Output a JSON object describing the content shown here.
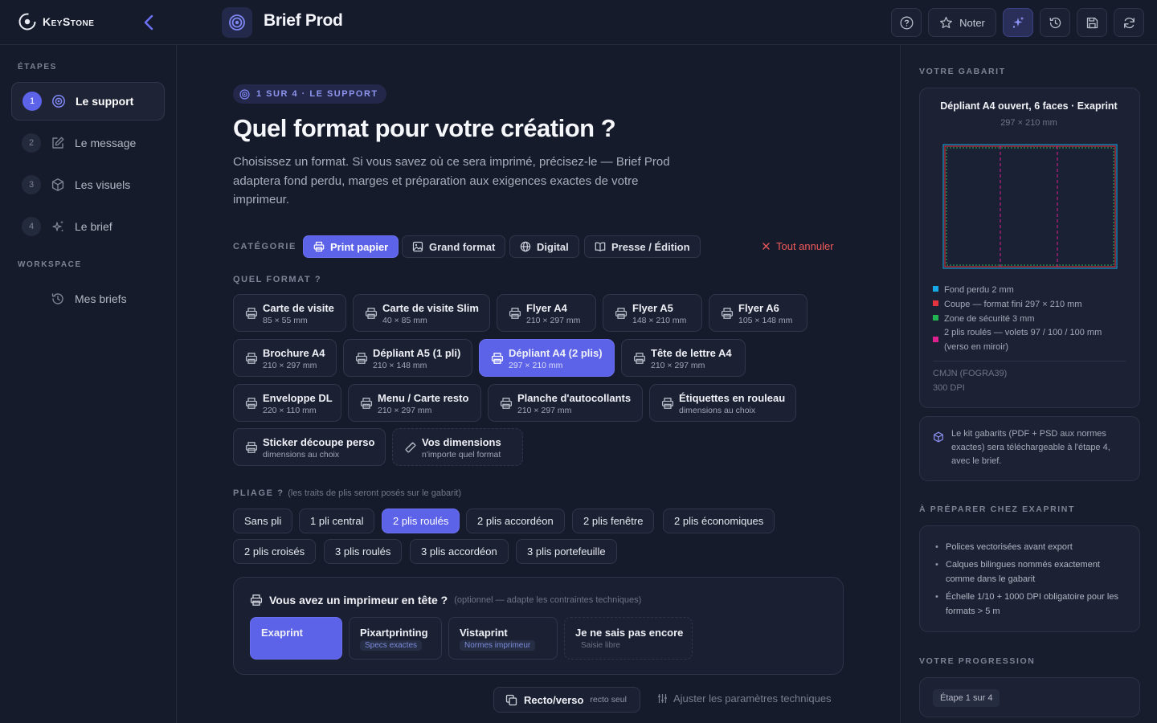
{
  "app": {
    "logo_text": "KeyStone",
    "project_title": "Brief Prod"
  },
  "toolbar": {
    "rate_label": "Noter"
  },
  "sidebar": {
    "steps_heading": "ÉTAPES",
    "steps": [
      {
        "num": "1",
        "label": "Le support",
        "icon": "target-icon",
        "active": true
      },
      {
        "num": "2",
        "label": "Le message",
        "icon": "edit-icon"
      },
      {
        "num": "3",
        "label": "Les visuels",
        "icon": "cube-icon"
      },
      {
        "num": "4",
        "label": "Le brief",
        "icon": "sparkles-icon"
      }
    ],
    "workspace_heading": "WORKSPACE",
    "workspace_items": [
      {
        "label": "Mes briefs",
        "icon": "history-icon"
      }
    ]
  },
  "main": {
    "crumb": "1 SUR 4 · LE SUPPORT",
    "title": "Quel format pour votre création ?",
    "lede": "Choisissez un format. Si vous savez où ce sera imprimé, précisez-le — Brief Prod adaptera fond perdu, marges et préparation aux exigences exactes de votre imprimeur.",
    "category_label": "CATÉGORIE",
    "categories": [
      {
        "label": "Print papier",
        "active": true
      },
      {
        "label": "Grand format"
      },
      {
        "label": "Digital"
      },
      {
        "label": "Presse / Édition"
      }
    ],
    "cancel_label": "Tout annuler",
    "format_label": "QUEL FORMAT ?",
    "formats": [
      {
        "name": "Carte de visite",
        "dim": "85 × 55 mm"
      },
      {
        "name": "Carte de visite Slim",
        "dim": "40 × 85 mm"
      },
      {
        "name": "Flyer A4",
        "dim": "210 × 297 mm"
      },
      {
        "name": "Flyer A5",
        "dim": "148 × 210 mm"
      },
      {
        "name": "Flyer A6",
        "dim": "105 × 148 mm"
      },
      {
        "name": "Brochure A4",
        "dim": "210 × 297 mm"
      },
      {
        "name": "Dépliant A5 (1 pli)",
        "dim": "210 × 148 mm"
      },
      {
        "name": "Dépliant A4 (2 plis)",
        "dim": "297 × 210 mm",
        "active": true
      },
      {
        "name": "Tête de lettre A4",
        "dim": "210 × 297 mm"
      },
      {
        "name": "Enveloppe DL",
        "dim": "220 × 110 mm"
      },
      {
        "name": "Menu / Carte resto",
        "dim": "210 × 297 mm"
      },
      {
        "name": "Planche d'autocollants",
        "dim": "210 × 297 mm"
      },
      {
        "name": "Étiquettes en rouleau",
        "dim": "dimensions au choix"
      },
      {
        "name": "Sticker découpe perso",
        "dim": "dimensions au choix"
      },
      {
        "name": "Vos dimensions",
        "dim": "n'importe quel format"
      }
    ],
    "fold_label": "PLIAGE ?",
    "fold_sub": "(les traits de plis seront posés sur le gabarit)",
    "folds": [
      {
        "label": "Sans pli"
      },
      {
        "label": "1 pli central"
      },
      {
        "label": "2 plis roulés",
        "active": true
      },
      {
        "label": "2 plis accordéon"
      },
      {
        "label": "2 plis fenêtre"
      },
      {
        "label": "2 plis économiques"
      },
      {
        "label": "2 plis croisés"
      },
      {
        "label": "3 plis roulés"
      },
      {
        "label": "3 plis accordéon"
      },
      {
        "label": "3 plis portefeuille"
      }
    ],
    "printer": {
      "title": "Vous avez un imprimeur en tête ?",
      "subtitle": "(optionnel — adapte les contraintes techniques)",
      "options": [
        {
          "name": "Exaprint",
          "tag": "",
          "active": true
        },
        {
          "name": "Pixartprinting",
          "tag": "Specs exactes"
        },
        {
          "name": "Vistaprint",
          "tag": "Normes imprimeur"
        },
        {
          "name": "Je ne sais pas encore",
          "tag": "Saisie libre"
        }
      ]
    },
    "recto_label": "Recto/verso",
    "recto_value": "recto seul",
    "adjust_label": "Ajuster les paramètres techniques"
  },
  "right": {
    "template_heading": "VOTRE GABARIT",
    "template_title": "Dépliant A4 ouvert, 6 faces · Exaprint",
    "template_dim": "297 × 210 mm",
    "legend": [
      {
        "color": "#17a9e6",
        "text": "Fond perdu 2 mm"
      },
      {
        "color": "#e5343f",
        "text": "Coupe — format fini 297 × 210 mm"
      },
      {
        "color": "#21b350",
        "text": "Zone de sécurité 3 mm"
      },
      {
        "color": "#e0208e",
        "text": "2 plis roulés — volets 97 / 100 / 100 mm (verso en miroir)"
      }
    ],
    "color_profile": "CMJN (FOGRA39)",
    "resolution": "300 DPI",
    "kit_note": "Le kit gabarits (PDF + PSD aux normes exactes) sera téléchargeable à l'étape 4, avec le brief.",
    "prep_heading": "À PRÉPARER CHEZ EXAPRINT",
    "prep_items": [
      "Polices vectorisées avant export",
      "Calques bilingues nommés exactement comme dans le gabarit",
      "Échelle 1/10 + 1000 DPI obligatoire pour les formats > 5 m"
    ],
    "progress_heading": "VOTRE PROGRESSION",
    "progress_badge": "Étape 1 sur 4"
  },
  "colors": {
    "accent": "#5d63e8",
    "background": "#161b2b",
    "danger": "#ef5a5a"
  }
}
